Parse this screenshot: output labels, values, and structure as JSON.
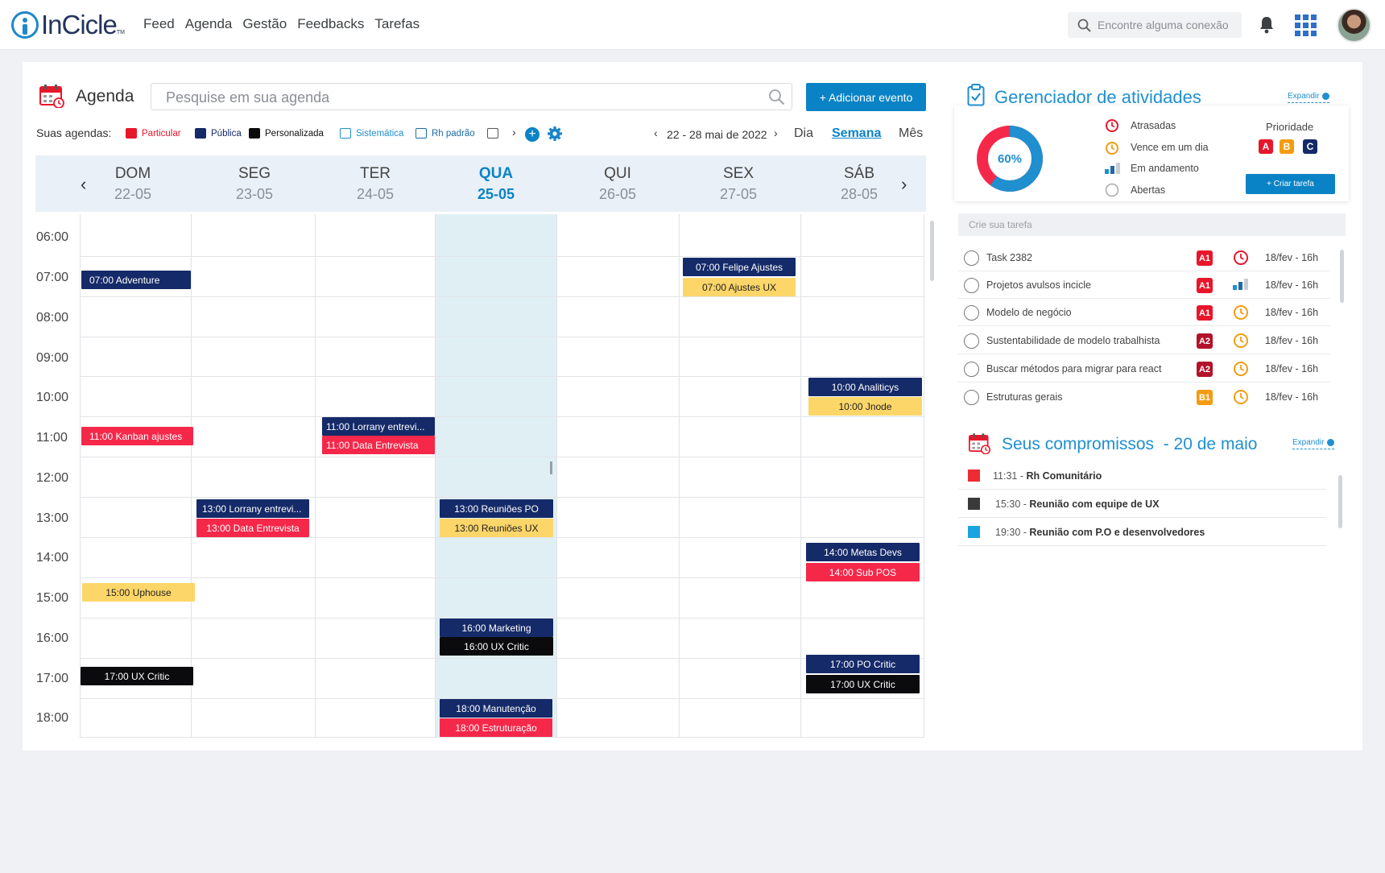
{
  "brand": {
    "name": "InCicle",
    "tm": "TM"
  },
  "nav": {
    "items": [
      "Feed",
      "Agenda",
      "Gestão",
      "Feedbacks",
      "Tarefas"
    ]
  },
  "search": {
    "placeholder": "Encontre alguma conexão"
  },
  "agenda": {
    "title": "Agenda",
    "search_placeholder": "Pesquise em sua agenda",
    "add_button": "+ Adicionar evento",
    "yours_label": "Suas agendas:",
    "legends": [
      {
        "label": "Particular",
        "color": "#e8162b",
        "type": "filled"
      },
      {
        "label": "Pública",
        "color": "#152a68",
        "type": "filled"
      },
      {
        "label": "Personalizada",
        "color": "#0b0b0d",
        "type": "filled"
      },
      {
        "label": "Sistemática",
        "color": "#1f8fd0",
        "type": "outline"
      },
      {
        "label": "Rh padrão",
        "color": "#152a68",
        "type": "outline"
      }
    ],
    "range": "22 - 28 mai de 2022",
    "views": {
      "day": "Dia",
      "week": "Semana",
      "month": "Mês"
    },
    "days": [
      {
        "name": "DOM",
        "date": "22-05"
      },
      {
        "name": "SEG",
        "date": "23-05"
      },
      {
        "name": "TER",
        "date": "24-05"
      },
      {
        "name": "QUA",
        "date": "25-05",
        "today": true
      },
      {
        "name": "QUI",
        "date": "26-05"
      },
      {
        "name": "SEX",
        "date": "27-05"
      },
      {
        "name": "SÁB",
        "date": "28-05"
      }
    ],
    "hours": [
      "06:00",
      "07:00",
      "08:00",
      "09:00",
      "10:00",
      "11:00",
      "12:00",
      "13:00",
      "14:00",
      "15:00",
      "16:00",
      "17:00",
      "18:00"
    ],
    "events": [
      {
        "day": 0,
        "label": "07:00 Adventure",
        "color": "navy"
      },
      {
        "day": 5,
        "label": "07:00 Felipe Ajustes",
        "color": "navy"
      },
      {
        "day": 5,
        "label": "07:00 Ajustes UX",
        "color": "yellow"
      },
      {
        "day": 6,
        "label": "10:00 Analiticys",
        "color": "navy"
      },
      {
        "day": 6,
        "label": "10:00 Jnode",
        "color": "yellow"
      },
      {
        "day": 2,
        "label": "11:00 Lorrany entrevi...",
        "color": "navy"
      },
      {
        "day": 0,
        "label": "11:00 Kanban ajustes",
        "color": "red"
      },
      {
        "day": 2,
        "label": "11:00 Data Entrevista",
        "color": "red"
      },
      {
        "day": 1,
        "label": "13:00 Lorrany entrevi...",
        "color": "navy"
      },
      {
        "day": 3,
        "label": "13:00 Reuniões PO",
        "color": "navy"
      },
      {
        "day": 1,
        "label": "13:00 Data Entrevista",
        "color": "red"
      },
      {
        "day": 3,
        "label": "13:00 Reuniões UX",
        "color": "yellow"
      },
      {
        "day": 6,
        "label": "14:00 Metas Devs",
        "color": "navy"
      },
      {
        "day": 6,
        "label": "14:00 Sub POS",
        "color": "red"
      },
      {
        "day": 0,
        "label": "15:00 Uphouse",
        "color": "yellow"
      },
      {
        "day": 3,
        "label": "16:00 Marketing",
        "color": "navy"
      },
      {
        "day": 3,
        "label": "16:00 UX Critic",
        "color": "black"
      },
      {
        "day": 6,
        "label": "17:00 PO Critic",
        "color": "navy"
      },
      {
        "day": 0,
        "label": "17:00 UX Critic",
        "color": "black"
      },
      {
        "day": 6,
        "label": "17:00 UX Critic",
        "color": "black"
      },
      {
        "day": 3,
        "label": "18:00 Manutenção",
        "color": "navy"
      },
      {
        "day": 3,
        "label": "18:00 Estruturação",
        "color": "red"
      }
    ]
  },
  "activities": {
    "title": "Gerenciador de atividades",
    "expand": "Expandir",
    "percent": "60%",
    "progress": 0.6,
    "stats": [
      "Atrasadas",
      "Vence em um dia",
      "Em andamento",
      "Abertas"
    ],
    "priority_label": "Prioridade",
    "priorities": [
      {
        "label": "A",
        "color": "#e8162b"
      },
      {
        "label": "B",
        "color": "#f39c12"
      },
      {
        "label": "C",
        "color": "#152a68"
      }
    ],
    "create_button": "+ Criar tarefa",
    "create_placeholder": "Crie sua tarefa",
    "tasks": [
      {
        "name": "Task 2382",
        "badge": "A1",
        "badge_color": "#e8162b",
        "status": "late",
        "date": "18/fev - 16h"
      },
      {
        "name": "Projetos avulsos incicle",
        "badge": "A1",
        "badge_color": "#e8162b",
        "status": "progress",
        "date": "18/fev - 16h"
      },
      {
        "name": "Modelo de negócio",
        "badge": "A1",
        "badge_color": "#e8162b",
        "status": "due",
        "date": "18/fev - 16h"
      },
      {
        "name": "Sustentabilidade de modelo trabalhista",
        "badge": "A2",
        "badge_color": "#b3122a",
        "status": "due",
        "date": "18/fev - 16h"
      },
      {
        "name": "Buscar métodos para migrar para react",
        "badge": "A2",
        "badge_color": "#b3122a",
        "status": "due",
        "date": "18/fev - 16h"
      },
      {
        "name": "Estruturas gerais",
        "badge": "B1",
        "badge_color": "#f39c12",
        "status": "due",
        "date": "18/fev - 16h"
      }
    ]
  },
  "commitments": {
    "title": "Seus compromissos  - 20 de maio",
    "expand": "Expandir",
    "items": [
      {
        "time": "11:31 -",
        "title": "Rh Comunitário",
        "color": "#ee2b33"
      },
      {
        "time": "15:30 -",
        "title": "Reunião com equipe de UX",
        "color": "#3a3a3a"
      },
      {
        "time": "19:30 -",
        "title": "Reunião com P.O e desenvolvedores",
        "color": "#1aa3e0"
      }
    ]
  }
}
